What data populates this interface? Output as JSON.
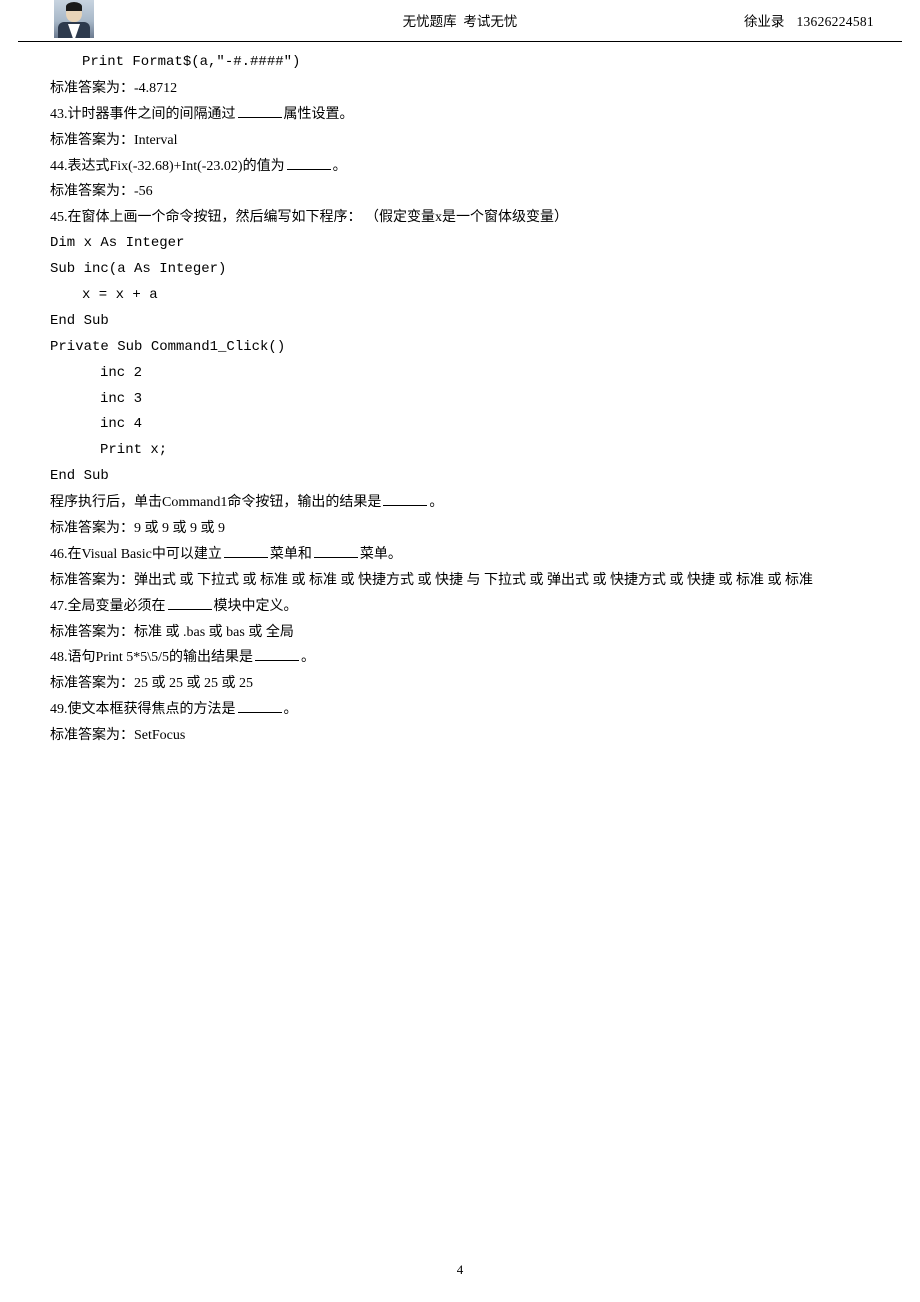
{
  "header": {
    "title_left": "无忧题库",
    "title_right": "考试无忧",
    "author": "徐业录",
    "phone": "13626224581"
  },
  "content": {
    "line_print_format": "Print Format$(a,\"-#.####\")",
    "q42_answer_prefix": "标准答案为：",
    "q42_answer": "-4.8712",
    "q43_pre": "43.计时器事件之间的间隔通过",
    "q43_post": "属性设置。",
    "q43_answer_prefix": "标准答案为：",
    "q43_answer": "Interval",
    "q44_pre": "44.表达式Fix(-32.68)+Int(-23.02)的值为",
    "q44_post": "。",
    "q44_answer_prefix": "标准答案为：",
    "q44_answer": "-56",
    "q45_text": "45.在窗体上画一个命令按钮，然后编写如下程序： （假定变量x是一个窗体级变量）",
    "q45_code1": "Dim x As Integer",
    "q45_code2": "Sub inc(a As Integer)",
    "q45_code3": "x = x + a",
    "q45_code4": "End Sub",
    "q45_code5": "Private Sub Command1_Click()",
    "q45_code6": "inc 2",
    "q45_code7": "inc 3",
    "q45_code8": "inc 4",
    "q45_code9": "Print x;",
    "q45_code10": "End Sub",
    "q45_after_pre": "程序执行后，单击Command1命令按钮，输出的结果是",
    "q45_after_post": "。",
    "q45_answer_prefix": "标准答案为：",
    "q45_answer": "9 或 9 或 9 或 9",
    "q46_pre": "46.在Visual Basic中可以建立",
    "q46_mid": "菜单和",
    "q46_post": "菜单。",
    "q46_answer_prefix": "标准答案为：",
    "q46_answer": "弹出式 或 下拉式 或 标准 或 标准 或 快捷方式 或 快捷 与 下拉式 或 弹出式 或 快捷方式 或 快捷 或 标准 或 标准",
    "q47_pre": "47.全局变量必须在",
    "q47_post": "模块中定义。",
    "q47_answer_prefix": "标准答案为：",
    "q47_answer": "标准 或 .bas 或 bas 或 全局",
    "q48_pre": "48.语句Print 5*5\\5/5的输出结果是",
    "q48_post": "。",
    "q48_answer_prefix": "标准答案为：",
    "q48_answer": "25 或 25 或 25 或 25",
    "q49_pre": "49.使文本框获得焦点的方法是",
    "q49_post": "。",
    "q49_answer_prefix": "标准答案为：",
    "q49_answer": "SetFocus"
  },
  "page_number": "4"
}
